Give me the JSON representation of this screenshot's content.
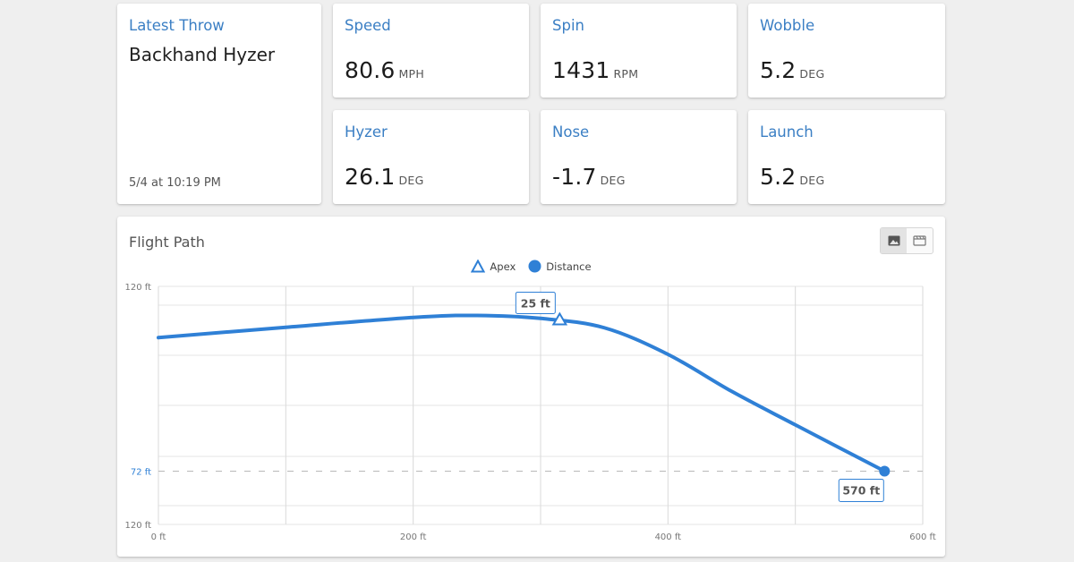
{
  "latest": {
    "label": "Latest Throw",
    "title": "Backhand Hyzer",
    "date": "5/4 at 10:19 PM"
  },
  "stats": {
    "speed": {
      "label": "Speed",
      "value": "80.6",
      "unit": "MPH"
    },
    "spin": {
      "label": "Spin",
      "value": "1431",
      "unit": "RPM"
    },
    "wobble": {
      "label": "Wobble",
      "value": "5.2",
      "unit": "DEG"
    },
    "hyzer": {
      "label": "Hyzer",
      "value": "26.1",
      "unit": "DEG"
    },
    "nose": {
      "label": "Nose",
      "value": "-1.7",
      "unit": "DEG"
    },
    "launch": {
      "label": "Launch",
      "value": "5.2",
      "unit": "DEG"
    }
  },
  "flight_path": {
    "title": "Flight Path",
    "toggle_icons": [
      "image-icon",
      "movie-icon"
    ],
    "accent_color": "#2f80d6"
  },
  "chart_data": {
    "type": "line",
    "title": "",
    "xlabel": "",
    "ylabel": "",
    "xlim": [
      0,
      600
    ],
    "x_ticks": [
      "0 ft",
      "200 ft",
      "400 ft",
      "600 ft"
    ],
    "y_ticks": [
      "120 ft",
      "72 ft",
      "120 ft"
    ],
    "legend": [
      "Apex",
      "Distance"
    ],
    "legend_position": "top-center",
    "grid": true,
    "series": [
      {
        "x": [
          0,
          100,
          200,
          250,
          300,
          350,
          400,
          450,
          500,
          570
        ],
        "y": [
          92.2,
          94.3,
          96.3,
          96.7,
          96.1,
          94.2,
          88.8,
          81.3,
          74.5,
          65.1
        ]
      }
    ],
    "apex": {
      "x": 315,
      "y": 95.8,
      "label": "25 ft"
    },
    "distance": {
      "x": 570,
      "y": 65.1,
      "label": "570 ft"
    },
    "reference_line": {
      "y": 65.1,
      "label": "72 ft"
    },
    "y_plot_range": [
      54.3,
      102.6
    ]
  }
}
